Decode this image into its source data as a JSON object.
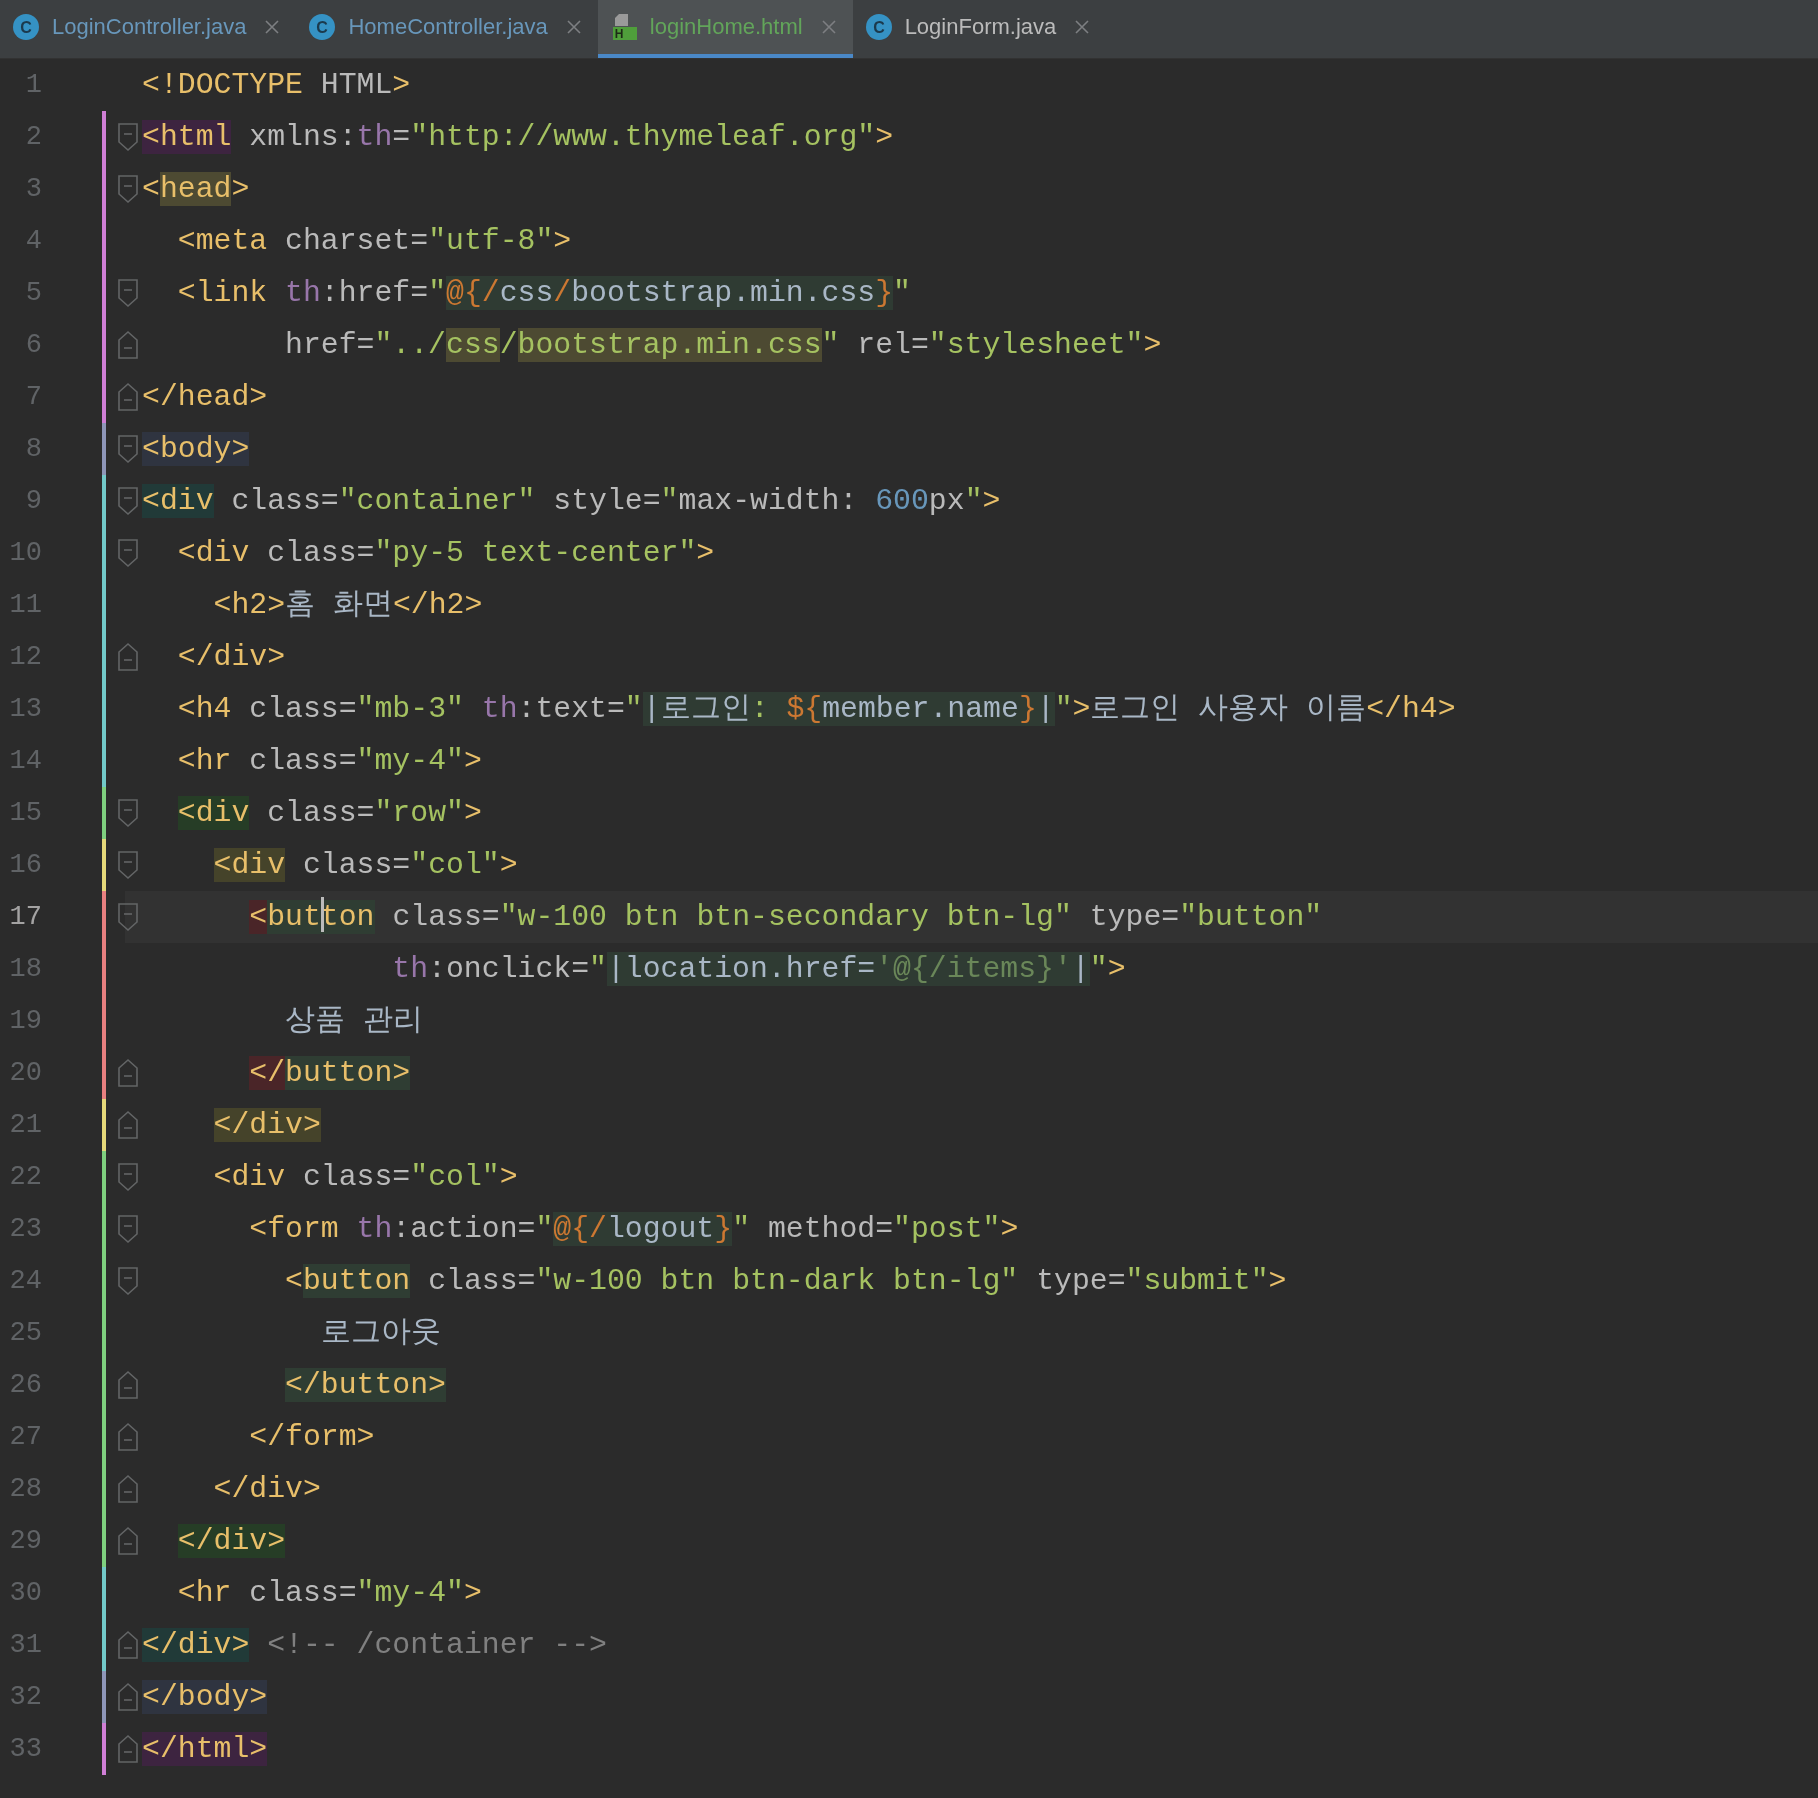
{
  "tabs": [
    {
      "label": "LoginController.java",
      "kind": "java",
      "icon_letter": "C",
      "color": "#6897bb",
      "selected": false
    },
    {
      "label": "HomeController.java",
      "kind": "java",
      "icon_letter": "C",
      "color": "#6897bb",
      "selected": false
    },
    {
      "label": "loginHome.html",
      "kind": "html",
      "icon_letter": "H",
      "color": "#62a55a",
      "selected": true
    },
    {
      "label": "LoginForm.java",
      "kind": "java",
      "icon_letter": "C",
      "color": "#bbbbbb",
      "selected": false
    }
  ],
  "editor": {
    "lines": [
      {
        "number": "1",
        "current": false,
        "kind": "plain",
        "segments": [
          {
            "text": "<!DOCTYPE",
            "kind": "tag"
          },
          {
            "text": " HTML",
            "kind": "attr"
          },
          {
            "text": ">",
            "kind": "tag"
          }
        ]
      },
      {
        "number": "2",
        "current": false,
        "kind": "fold-start",
        "color": "#d07fd6",
        "segments": [
          {
            "text": "<html",
            "kind": "tag",
            "color": "#3d2440"
          },
          {
            "text": " xmlns:",
            "kind": "attr"
          },
          {
            "text": "th",
            "kind": "ns"
          },
          {
            "text": "=",
            "kind": "attr"
          },
          {
            "text": "\"http://www.thymeleaf.org\"",
            "kind": "str"
          },
          {
            "text": ">",
            "kind": "tag"
          }
        ]
      },
      {
        "number": "3",
        "current": false,
        "kind": "fold-start",
        "color": "#d07fd6",
        "segments": [
          {
            "text": "<",
            "kind": "tag"
          },
          {
            "text": "head",
            "kind": "tag",
            "color": "#4d4a32"
          },
          {
            "text": ">",
            "kind": "tag"
          }
        ]
      },
      {
        "number": "4",
        "current": false,
        "kind": "plain",
        "color": "#d07fd6",
        "segments": [
          {
            "text": "  <meta",
            "kind": "tag"
          },
          {
            "text": " charset=",
            "kind": "attr"
          },
          {
            "text": "\"utf-8\"",
            "kind": "str"
          },
          {
            "text": ">",
            "kind": "tag"
          }
        ]
      },
      {
        "number": "5",
        "current": false,
        "kind": "fold-start",
        "color": "#d07fd6",
        "segments": [
          {
            "text": "  <link",
            "kind": "tag"
          },
          {
            "text": " th",
            "kind": "ns"
          },
          {
            "text": ":href=",
            "kind": "attr"
          },
          {
            "text": "\"",
            "kind": "str"
          },
          {
            "text": "@{/",
            "kind": "expr",
            "color": "#2f3b33"
          },
          {
            "text": "css",
            "kind": "expr-text",
            "color": "#2f3b33"
          },
          {
            "text": "/",
            "kind": "expr",
            "color": "#2f3b33"
          },
          {
            "text": "bootstrap.min.css",
            "kind": "expr-text",
            "color": "#2f3b33"
          },
          {
            "text": "}",
            "kind": "expr",
            "color": "#2f3b33"
          },
          {
            "text": "\"",
            "kind": "str"
          }
        ]
      },
      {
        "number": "6",
        "current": false,
        "kind": "fold-end",
        "color": "#d07fd6",
        "segments": [
          {
            "text": "        href=",
            "kind": "attr"
          },
          {
            "text": "\"../",
            "kind": "str"
          },
          {
            "text": "css",
            "kind": "str",
            "color": "#4d4a32"
          },
          {
            "text": "/",
            "kind": "str"
          },
          {
            "text": "bootstrap.min.css",
            "kind": "str",
            "color": "#4d4a32"
          },
          {
            "text": "\"",
            "kind": "str"
          },
          {
            "text": " rel=",
            "kind": "attr"
          },
          {
            "text": "\"stylesheet\"",
            "kind": "str"
          },
          {
            "text": ">",
            "kind": "tag"
          }
        ]
      },
      {
        "number": "7",
        "current": false,
        "kind": "fold-end",
        "color": "#d07fd6",
        "segments": [
          {
            "text": "</head>",
            "kind": "tag"
          }
        ]
      },
      {
        "number": "8",
        "current": false,
        "kind": "fold-start",
        "color": "#8e96b8",
        "segments": [
          {
            "text": "<body>",
            "kind": "tag",
            "color": "#2f3440"
          }
        ]
      },
      {
        "number": "9",
        "current": false,
        "kind": "fold-start",
        "color": "#72c9c9",
        "segments": [
          {
            "text": "<div",
            "kind": "tag",
            "color": "#213a38"
          },
          {
            "text": " class=",
            "kind": "attr"
          },
          {
            "text": "\"container\"",
            "kind": "str"
          },
          {
            "text": " style=",
            "kind": "attr"
          },
          {
            "text": "\"",
            "kind": "str"
          },
          {
            "text": "max-width: ",
            "kind": "attr"
          },
          {
            "text": "600",
            "kind": "num"
          },
          {
            "text": "px",
            "kind": "attr"
          },
          {
            "text": "\"",
            "kind": "str"
          },
          {
            "text": ">",
            "kind": "tag"
          }
        ]
      },
      {
        "number": "10",
        "current": false,
        "kind": "fold-start",
        "color": "#72c9c9",
        "segments": [
          {
            "text": "  <div",
            "kind": "tag"
          },
          {
            "text": " class=",
            "kind": "attr"
          },
          {
            "text": "\"py-5 text-center\"",
            "kind": "str"
          },
          {
            "text": ">",
            "kind": "tag"
          }
        ]
      },
      {
        "number": "11",
        "current": false,
        "kind": "plain",
        "color": "#72c9c9",
        "segments": [
          {
            "text": "    <h2>",
            "kind": "tag"
          },
          {
            "text": "홈 화면",
            "kind": "text"
          },
          {
            "text": "</h2>",
            "kind": "tag"
          }
        ]
      },
      {
        "number": "12",
        "current": false,
        "kind": "fold-end",
        "color": "#72c9c9",
        "segments": [
          {
            "text": "  </div>",
            "kind": "tag"
          }
        ]
      },
      {
        "number": "13",
        "current": false,
        "kind": "plain",
        "color": "#72c9c9",
        "segments": [
          {
            "text": "  <h4",
            "kind": "tag"
          },
          {
            "text": " class=",
            "kind": "attr"
          },
          {
            "text": "\"mb-3\"",
            "kind": "str"
          },
          {
            "text": " th",
            "kind": "ns"
          },
          {
            "text": ":text=",
            "kind": "attr"
          },
          {
            "text": "\"",
            "kind": "str"
          },
          {
            "text": "|로그인",
            "kind": "expr-text",
            "color": "#2f3b33"
          },
          {
            "text": ": ",
            "kind": "str",
            "color": "#2f3b33"
          },
          {
            "text": "${",
            "kind": "expr",
            "color": "#2f3b33"
          },
          {
            "text": "member.name",
            "kind": "expr-text",
            "color": "#2f3b33"
          },
          {
            "text": "}",
            "kind": "expr",
            "color": "#2f3b33"
          },
          {
            "text": "|",
            "kind": "expr-text",
            "color": "#2f3b33"
          },
          {
            "text": "\"",
            "kind": "str"
          },
          {
            "text": ">",
            "kind": "tag"
          },
          {
            "text": "로그인 사용자 이름",
            "kind": "text"
          },
          {
            "text": "</h4>",
            "kind": "tag"
          }
        ]
      },
      {
        "number": "14",
        "current": false,
        "kind": "plain",
        "color": "#72c9c9",
        "segments": [
          {
            "text": "  <hr",
            "kind": "tag"
          },
          {
            "text": " class=",
            "kind": "attr"
          },
          {
            "text": "\"my-4\"",
            "kind": "str"
          },
          {
            "text": ">",
            "kind": "tag"
          }
        ]
      },
      {
        "number": "15",
        "current": false,
        "kind": "fold-start",
        "color": "#7fd07f",
        "segments": [
          {
            "text": "  <div",
            "kind": "tag",
            "color": "#263d26"
          },
          {
            "text": " class=",
            "kind": "attr"
          },
          {
            "text": "\"row\"",
            "kind": "str"
          },
          {
            "text": ">",
            "kind": "tag"
          }
        ]
      },
      {
        "number": "16",
        "current": false,
        "kind": "fold-start",
        "color": "#e6d97a",
        "segments": [
          {
            "text": "    <div",
            "kind": "tag",
            "color": "#45432a"
          },
          {
            "text": " class=",
            "kind": "attr"
          },
          {
            "text": "\"col\"",
            "kind": "str"
          },
          {
            "text": ">",
            "kind": "tag"
          }
        ]
      },
      {
        "number": "17",
        "current": true,
        "kind": "fold-start",
        "color": "#e88080",
        "segments": [
          {
            "text": "      <",
            "kind": "tag",
            "color": "#4a2528"
          },
          {
            "text": "but",
            "kind": "tag",
            "color": "#2f3d33",
            "caret": true
          },
          {
            "text": "ton",
            "kind": "tag",
            "color": "#2f3d33"
          },
          {
            "text": " class=",
            "kind": "attr"
          },
          {
            "text": "\"w-100 btn btn-secondary btn-lg\"",
            "kind": "str"
          },
          {
            "text": " type=",
            "kind": "attr"
          },
          {
            "text": "\"button\"",
            "kind": "str"
          }
        ]
      },
      {
        "number": "18",
        "current": false,
        "kind": "plain",
        "color": "#e88080",
        "segments": [
          {
            "text": "              th",
            "kind": "ns"
          },
          {
            "text": ":onclick=",
            "kind": "attr"
          },
          {
            "text": "\"",
            "kind": "str"
          },
          {
            "text": "|location.href=",
            "kind": "expr-text",
            "color": "#2f3b33"
          },
          {
            "text": "'@{/items}'",
            "kind": "str-dim",
            "color": "#2f3b33"
          },
          {
            "text": "|",
            "kind": "expr-text",
            "color": "#2f3b33"
          },
          {
            "text": "\"",
            "kind": "str"
          },
          {
            "text": ">",
            "kind": "tag"
          }
        ]
      },
      {
        "number": "19",
        "current": false,
        "kind": "plain",
        "color": "#e88080",
        "segments": [
          {
            "text": "        상품 관리",
            "kind": "text"
          }
        ]
      },
      {
        "number": "20",
        "current": false,
        "kind": "fold-end",
        "color": "#e88080",
        "segments": [
          {
            "text": "      </",
            "kind": "tag",
            "color": "#4a2528"
          },
          {
            "text": "button>",
            "kind": "tag",
            "color": "#2f3d33"
          }
        ]
      },
      {
        "number": "21",
        "current": false,
        "kind": "fold-end",
        "color": "#e6d97a",
        "segments": [
          {
            "text": "    </div>",
            "kind": "tag",
            "color": "#45432a"
          }
        ]
      },
      {
        "number": "22",
        "current": false,
        "kind": "fold-start",
        "color": "#7fd07f",
        "segments": [
          {
            "text": "    <div",
            "kind": "tag"
          },
          {
            "text": " class=",
            "kind": "attr"
          },
          {
            "text": "\"col\"",
            "kind": "str"
          },
          {
            "text": ">",
            "kind": "tag"
          }
        ]
      },
      {
        "number": "23",
        "current": false,
        "kind": "fold-start",
        "color": "#7fd07f",
        "segments": [
          {
            "text": "      <form",
            "kind": "tag"
          },
          {
            "text": " th",
            "kind": "ns"
          },
          {
            "text": ":action=",
            "kind": "attr"
          },
          {
            "text": "\"",
            "kind": "str"
          },
          {
            "text": "@{/",
            "kind": "expr",
            "color": "#2f3b33"
          },
          {
            "text": "logout",
            "kind": "expr-text",
            "color": "#2f3b33"
          },
          {
            "text": "}",
            "kind": "expr",
            "color": "#2f3b33"
          },
          {
            "text": "\"",
            "kind": "str"
          },
          {
            "text": " method=",
            "kind": "attr"
          },
          {
            "text": "\"post\"",
            "kind": "str"
          },
          {
            "text": ">",
            "kind": "tag"
          }
        ]
      },
      {
        "number": "24",
        "current": false,
        "kind": "fold-start",
        "color": "#7fd07f",
        "segments": [
          {
            "text": "        <",
            "kind": "tag"
          },
          {
            "text": "button",
            "kind": "tag",
            "color": "#2f3d33"
          },
          {
            "text": " class=",
            "kind": "attr"
          },
          {
            "text": "\"w-100 btn btn-dark btn-lg\"",
            "kind": "str"
          },
          {
            "text": " type=",
            "kind": "attr"
          },
          {
            "text": "\"submit\"",
            "kind": "str"
          },
          {
            "text": ">",
            "kind": "tag"
          }
        ]
      },
      {
        "number": "25",
        "current": false,
        "kind": "plain",
        "color": "#7fd07f",
        "segments": [
          {
            "text": "          로그아웃",
            "kind": "text"
          }
        ]
      },
      {
        "number": "26",
        "current": false,
        "kind": "fold-end",
        "color": "#7fd07f",
        "segments": [
          {
            "text": "        </button>",
            "kind": "tag",
            "color": "#2f3d33"
          }
        ]
      },
      {
        "number": "27",
        "current": false,
        "kind": "fold-end",
        "color": "#7fd07f",
        "segments": [
          {
            "text": "      </form>",
            "kind": "tag"
          }
        ]
      },
      {
        "number": "28",
        "current": false,
        "kind": "fold-end",
        "color": "#7fd07f",
        "segments": [
          {
            "text": "    </div>",
            "kind": "tag"
          }
        ]
      },
      {
        "number": "29",
        "current": false,
        "kind": "fold-end",
        "color": "#7fd07f",
        "segments": [
          {
            "text": "  </div>",
            "kind": "tag",
            "color": "#263d26"
          }
        ]
      },
      {
        "number": "30",
        "current": false,
        "kind": "plain",
        "color": "#72c9c9",
        "segments": [
          {
            "text": "  <hr",
            "kind": "tag"
          },
          {
            "text": " class=",
            "kind": "attr"
          },
          {
            "text": "\"my-4\"",
            "kind": "str"
          },
          {
            "text": ">",
            "kind": "tag"
          }
        ]
      },
      {
        "number": "31",
        "current": false,
        "kind": "fold-end",
        "color": "#72c9c9",
        "segments": [
          {
            "text": "</div>",
            "kind": "tag",
            "color": "#213a38"
          },
          {
            "text": " <!-- /container -->",
            "kind": "comment"
          }
        ]
      },
      {
        "number": "32",
        "current": false,
        "kind": "fold-end",
        "color": "#8e96b8",
        "segments": [
          {
            "text": "</body>",
            "kind": "tag",
            "color": "#2f3440"
          }
        ]
      },
      {
        "number": "33",
        "current": false,
        "kind": "fold-end",
        "color": "#d07fd6",
        "segments": [
          {
            "text": "</html>",
            "kind": "tag",
            "color": "#3d2440"
          }
        ]
      }
    ]
  }
}
